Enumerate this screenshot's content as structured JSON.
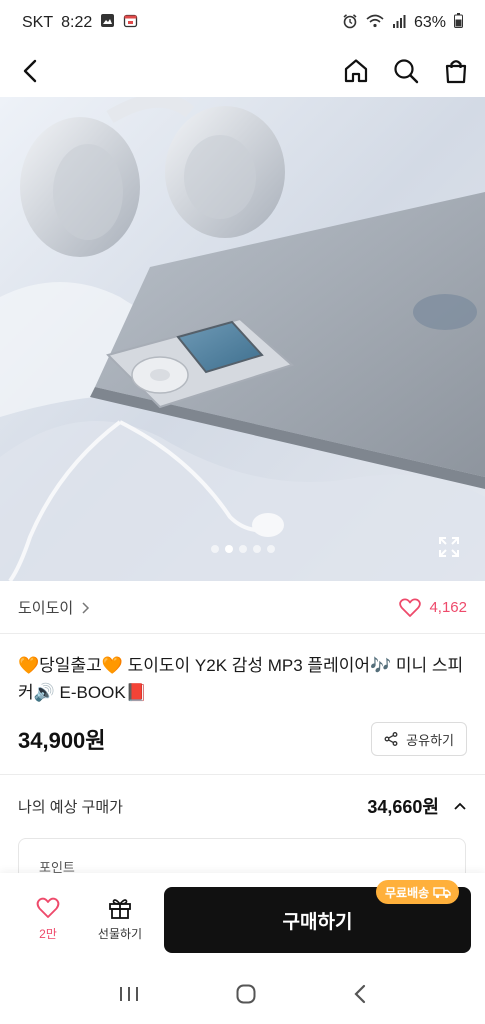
{
  "status_bar": {
    "carrier": "SKT",
    "time": "8:22",
    "battery": "63%",
    "icons": [
      "gallery-icon",
      "calendar-icon",
      "alarm-icon",
      "wifi-icon",
      "signal-icon",
      "battery-icon"
    ]
  },
  "header": {
    "icons": [
      "back-arrow-icon",
      "home-icon",
      "search-icon",
      "shopping-bag-icon"
    ]
  },
  "carousel": {
    "dot_count": 5,
    "active_index": 1
  },
  "seller": {
    "name": "도이도이",
    "like_count": "4,162"
  },
  "product": {
    "title": "🧡당일출고🧡 도이도이 Y2K 감성 MP3 플레이어🎶 미니 스피커🔊 E-BOOK📕",
    "price": "34,900원",
    "share_label": "공유하기"
  },
  "expected": {
    "label": "나의 예상 구매가",
    "price": "34,660원"
  },
  "points": {
    "label": "포인트"
  },
  "bottom_bar": {
    "wish_count": "2만",
    "gift_label": "선물하기",
    "buy_label": "구매하기",
    "ship_badge": "무료배송"
  },
  "colors": {
    "accent_pink": "#ee4a6b",
    "buy_button": "#111111",
    "badge_orange": "#ffb03b"
  }
}
